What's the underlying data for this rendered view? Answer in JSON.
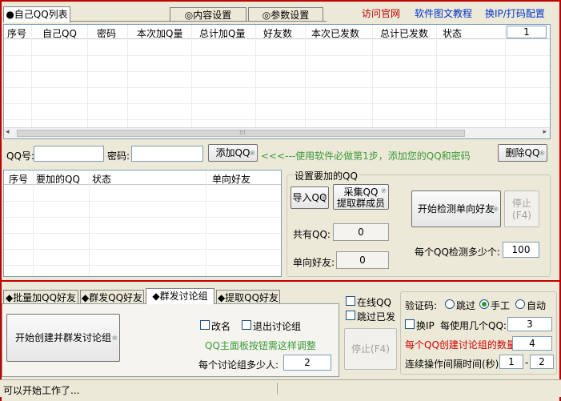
{
  "top_tabs": {
    "qq_list": "●自己QQ列表",
    "content_settings": "◎内容设置",
    "param_settings": "◎参数设置"
  },
  "links": {
    "official_site": "访问官网",
    "tutorial": "软件图文教程",
    "ip_config": "换IP/打码配置"
  },
  "colors": {
    "frame_red": "#c00000",
    "link_red": "#c00000",
    "link_blue": "#0033cc",
    "hint_green": "#3a9a3a",
    "warn_red": "#d00000"
  },
  "qq_table": {
    "columns": [
      "序号",
      "自己QQ",
      "密码",
      "本次加Q量",
      "总计加Q量",
      "好友数",
      "本次已发数",
      "总计已发数",
      "状态"
    ],
    "page_value": "1",
    "rows": []
  },
  "add_row": {
    "qq_label": "QQ号:",
    "qq_value": "",
    "pwd_label": "密码:",
    "pwd_value": "",
    "add_button": "添加QQ",
    "hint": "<<<---使用软件必做第1步，添加您的QQ和密码",
    "delete_button": "删除QQ"
  },
  "target_table": {
    "columns": [
      "序号",
      "要加的QQ",
      "状态",
      "单向好友"
    ],
    "rows": []
  },
  "target_settings": {
    "group_title": "设置要加的QQ",
    "import_button": "导入QQ",
    "collect_button_line1": "采集QQ",
    "collect_button_line2": "提取群成员",
    "total_label": "共有QQ:",
    "total_value": "0",
    "oneway_label": "单向好友:",
    "oneway_value": "0",
    "start_check_button": "开始检测单向好友",
    "stop_button_line1": "停止",
    "stop_button_line2": "(F4)",
    "per_qq_label": "每个QQ检测多少个:",
    "per_qq_value": "100"
  },
  "bottom_tabs": {
    "batch_add": "◆批量加QQ好友",
    "group_send": "◆群发QQ好友",
    "group_discuss": "◆群发讨论组",
    "extract": "◆提取QQ好友"
  },
  "discuss_panel": {
    "start_button": "开始创建并群发讨论组",
    "rename_label": "改名",
    "exit_label": "退出讨论组",
    "hint": "QQ主面板按钮需这样调整",
    "per_group_label": "每个讨论组多少人:",
    "per_group_value": "2"
  },
  "middle_options": {
    "online_label": "在线QQ",
    "skip_sent_label": "跳过已发",
    "stop_button": "停止(F4)"
  },
  "right_options": {
    "captcha_label": "验证码:",
    "captcha_options": [
      "跳过",
      "手工",
      "自动"
    ],
    "captcha_selected": "手工",
    "ip_label": "换IP",
    "qq_count_label": "每使用几个QQ:",
    "qq_count_value": "3",
    "create_count_label": "每个QQ创建讨论组的数量:",
    "create_count_value": "4",
    "interval_label": "连续操作间隔时间(秒)",
    "interval_from": "1",
    "interval_sep": "-",
    "interval_to": "2"
  },
  "status_bar": {
    "message": "可以开始工作了..."
  }
}
